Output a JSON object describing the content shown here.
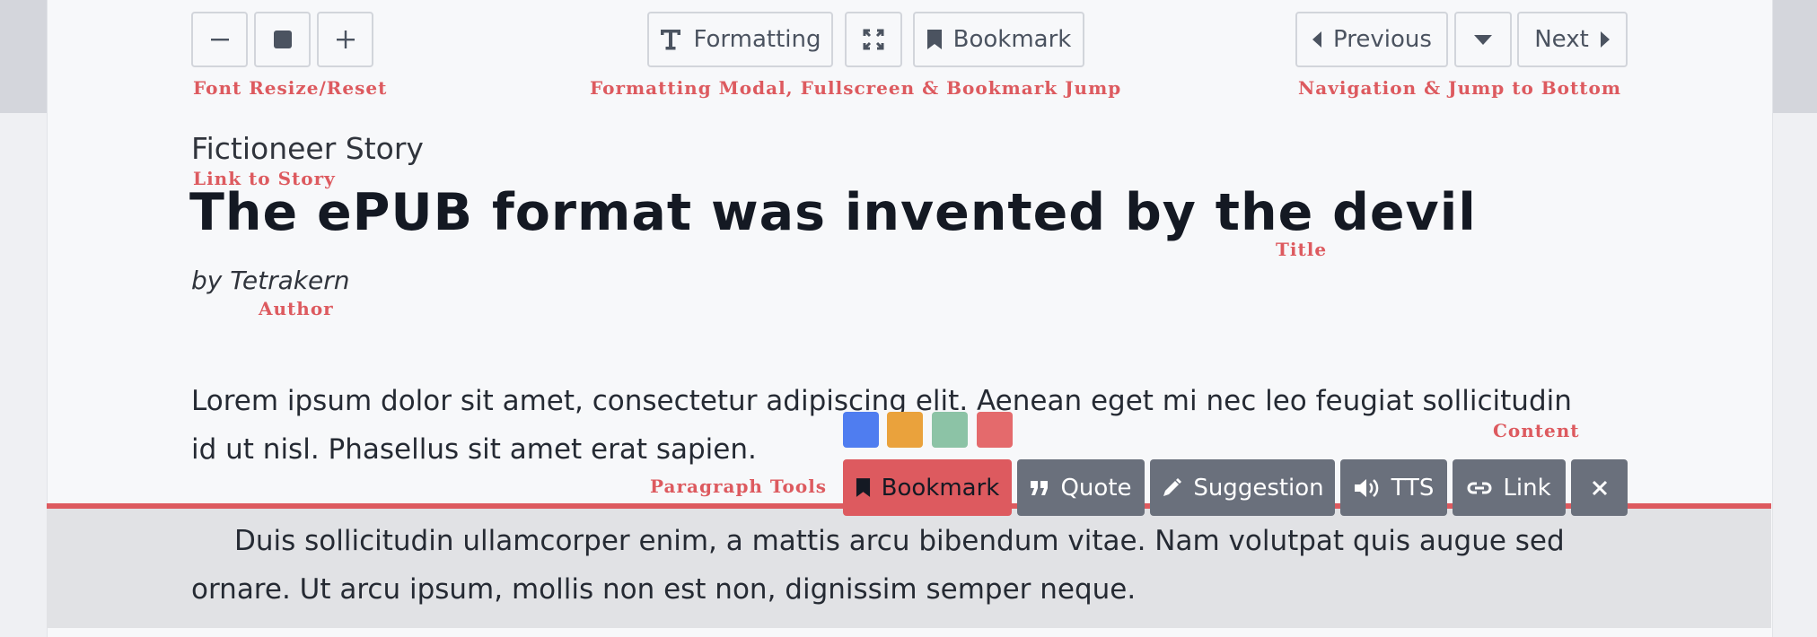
{
  "toolbar": {
    "font_buttons": {
      "decrease_icon": "minus-icon",
      "reset_icon": "square-icon",
      "increase_icon": "plus-icon"
    },
    "formatting_label": "Formatting",
    "bookmark_label": "Bookmark",
    "previous_label": "Previous",
    "next_label": "Next"
  },
  "annotations": {
    "font": "Font Resize/Reset",
    "formatting": "Formatting Modal, Fullscreen & Bookmark Jump",
    "navigation": "Navigation & Jump to Bottom",
    "story_link": "Link to Story",
    "title": "Title",
    "author": "Author",
    "content": "Content",
    "paragraph_tools": "Paragraph Tools"
  },
  "header": {
    "story_link": "Fictioneer Story",
    "title": "The ePUB format was invented by the devil",
    "author": "by Tetrakern"
  },
  "content": {
    "paragraph1": "Lorem ipsum dolor sit amet, consectetur adipiscing elit. Aenean eget mi nec leo feugiat sollicitudin id ut nisl. Phasellus sit amet erat sapien.",
    "paragraph2": "Duis sollicitudin ullamcorper enim, a mattis arcu bibendum vitae. Nam volutpat quis augue sed ornare. Ut arcu ipsum, mollis non est non, dignissim semper neque."
  },
  "paragraph_tools": {
    "bookmark_label": "Bookmark",
    "quote_label": "Quote",
    "suggestion_label": "Suggestion",
    "tts_label": "TTS",
    "link_label": "Link",
    "colors": [
      "#4f7df0",
      "#eaa23c",
      "#8cc3a6",
      "#e46a6c"
    ]
  },
  "colors": {
    "accent": "#dd5a5f",
    "tool_bg": "#6a707c"
  }
}
